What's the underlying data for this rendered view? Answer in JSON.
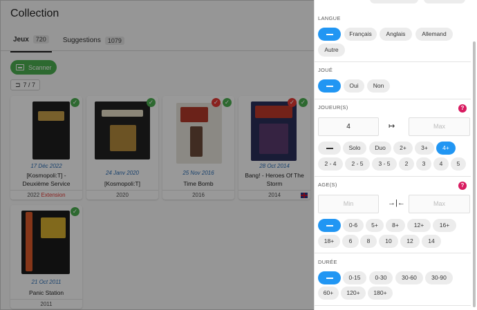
{
  "page": {
    "title": "Collection",
    "tabs": [
      {
        "label": "Jeux",
        "count": "720"
      },
      {
        "label": "Suggestions",
        "count": "1079"
      }
    ],
    "scan_label": "Scanner",
    "filter_count": "7 / 7"
  },
  "games": [
    {
      "date": "17 Déc 2022",
      "name": "[Kosmopoli:T] - Deuxième Service",
      "year": "2022",
      "extension": "Extension"
    },
    {
      "date": "24 Janv 2020",
      "name": "[Kosmopoli:T]",
      "year": "2020"
    },
    {
      "date": "25 Nov 2016",
      "name": "Time Bomb",
      "year": "2016"
    },
    {
      "date": "28 Oct 2014",
      "name": "Bang! - Heroes Of The Storm",
      "year": "2014"
    },
    {
      "date": "21 Oct 2011",
      "name": "Panic Station",
      "year": "2011"
    }
  ],
  "filters": {
    "langue": {
      "title": "LANGUE",
      "options": [
        "Français",
        "Anglais",
        "Allemand",
        "Autre"
      ]
    },
    "joue": {
      "title": "JOUÉ",
      "options": [
        "Oui",
        "Non"
      ]
    },
    "joueurs": {
      "title": "JOUEUR(S)",
      "help": "?",
      "min_value": "4",
      "max_placeholder": "Max",
      "options_row1": [
        "Solo",
        "Duo",
        "2+",
        "3+",
        "4+"
      ],
      "options_row2": [
        "2 - 4",
        "2 - 5",
        "3 - 5",
        "2",
        "3",
        "4",
        "5"
      ]
    },
    "age": {
      "title": "AGE(S)",
      "help": "?",
      "min_placeholder": "Min",
      "max_placeholder": "Max",
      "options_row1": [
        "0-6",
        "5+",
        "8+",
        "12+",
        "16+"
      ],
      "options_row2": [
        "18+",
        "6",
        "8",
        "10",
        "12",
        "14"
      ]
    },
    "duree": {
      "title": "DURÉE",
      "options_row1": [
        "0-15",
        "0-30",
        "30-60",
        "30-90"
      ],
      "options_row2": [
        "60+",
        "120+",
        "180+"
      ]
    }
  },
  "colors": {
    "accent": "#2196f3",
    "success": "#4caf50",
    "help": "#d81b60"
  }
}
